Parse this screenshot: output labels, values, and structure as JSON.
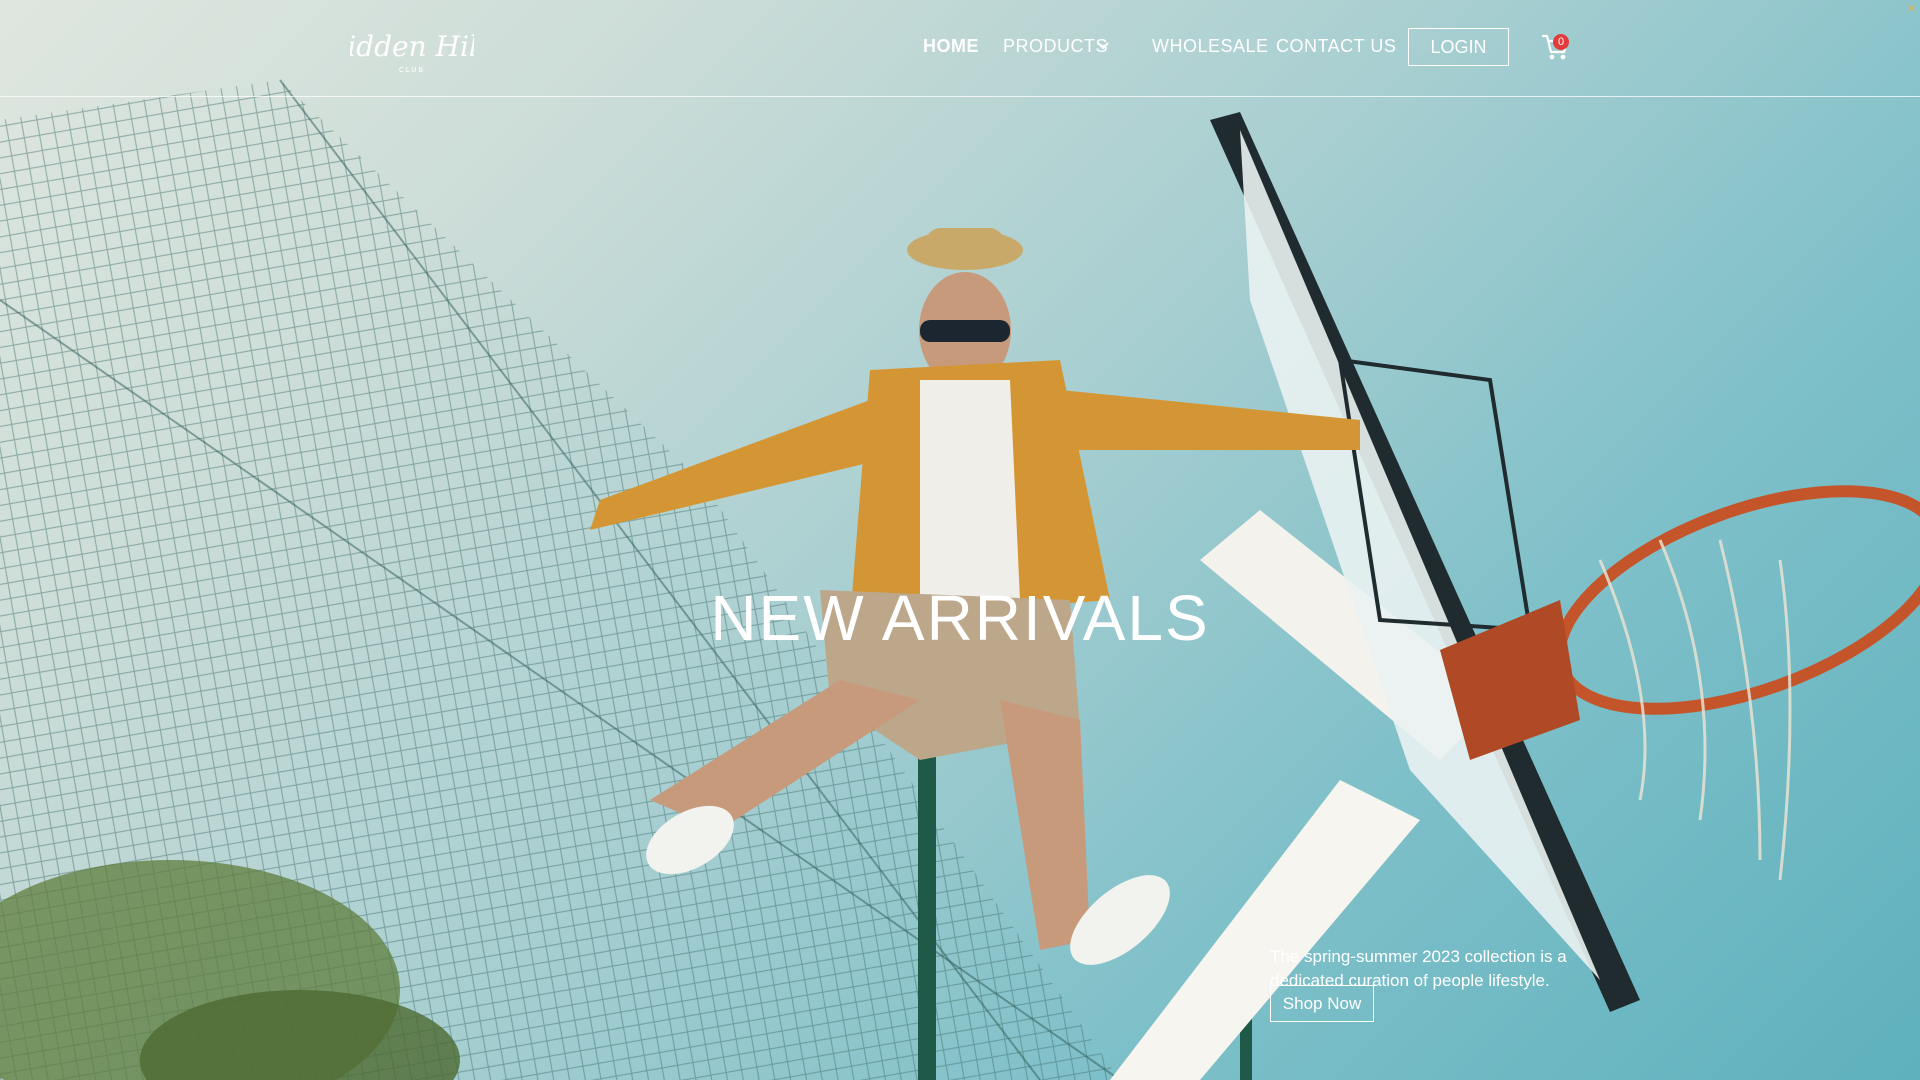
{
  "brand": {
    "logo_text": "Hidden Hills",
    "logo_sub": "CLUB"
  },
  "nav": {
    "home": "HOME",
    "products": "PRODUCTS",
    "wholesale": "WHOLESALE",
    "contact": "CONTACT US",
    "login": "LOGIN"
  },
  "cart": {
    "count": "0"
  },
  "hero": {
    "title": "NEW ARRIVALS",
    "description": "The spring-summer 2023 collection is a dedicated curation of people lifestyle.",
    "cta": "Shop Now"
  },
  "icons": [
    "chevron-down-icon",
    "cart-icon",
    "close-icon"
  ],
  "colors": {
    "badge": "#e23b3b",
    "text": "#ffffff",
    "sky": "#7fc0c9"
  }
}
